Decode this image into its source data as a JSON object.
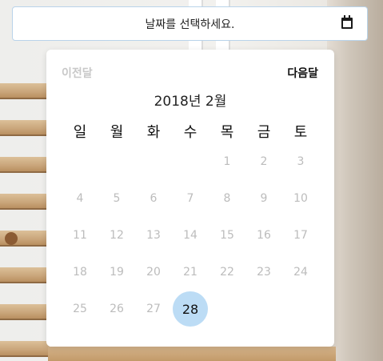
{
  "date_input": {
    "placeholder": "날짜를 선택하세요.",
    "icon": "calendar-icon"
  },
  "calendar": {
    "prev_label": "이전달",
    "next_label": "다음달",
    "month_title": "2018년 2월",
    "weekdays": [
      "일",
      "월",
      "화",
      "수",
      "목",
      "금",
      "토"
    ],
    "leading_blank_days": 4,
    "days": [
      "1",
      "2",
      "3",
      "4",
      "5",
      "6",
      "7",
      "8",
      "9",
      "10",
      "11",
      "12",
      "13",
      "14",
      "15",
      "16",
      "17",
      "18",
      "19",
      "20",
      "21",
      "22",
      "23",
      "24",
      "25",
      "26",
      "27",
      "28"
    ],
    "selected_day": "28"
  },
  "colors": {
    "selected_bg": "#bcdcf5",
    "disabled_text": "#bcbcbc",
    "input_border": "#b9d3ea"
  }
}
